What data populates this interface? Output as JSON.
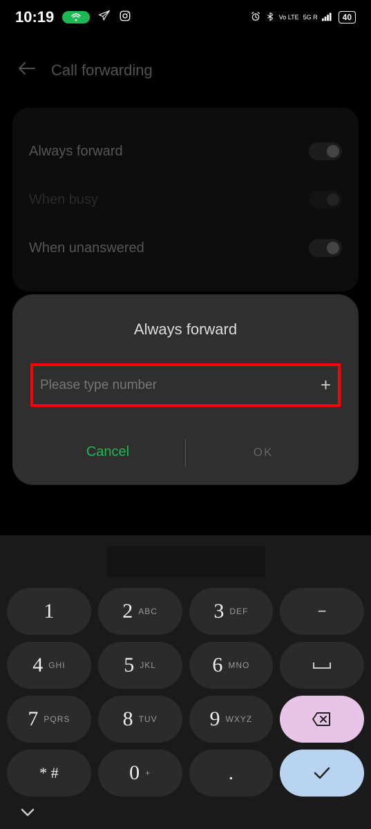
{
  "status": {
    "time": "10:19",
    "battery": "40",
    "volte": "Vo LTE",
    "network": "5G R"
  },
  "header": {
    "title": "Call forwarding"
  },
  "settings": {
    "always": "Always forward",
    "busy": "When busy",
    "unanswered": "When unanswered"
  },
  "dialog": {
    "title": "Always forward",
    "placeholder": "Please type number",
    "cancel": "Cancel",
    "ok": "OK"
  },
  "keypad": {
    "keys": [
      {
        "num": "1",
        "letters": ""
      },
      {
        "num": "2",
        "letters": "ABC"
      },
      {
        "num": "3",
        "letters": "DEF"
      },
      {
        "num": "4",
        "letters": "GHI"
      },
      {
        "num": "5",
        "letters": "JKL"
      },
      {
        "num": "6",
        "letters": "MNO"
      },
      {
        "num": "7",
        "letters": "PQRS"
      },
      {
        "num": "8",
        "letters": "TUV"
      },
      {
        "num": "9",
        "letters": "WXYZ"
      },
      {
        "num": "* #",
        "letters": ""
      },
      {
        "num": "0",
        "letters": "+"
      },
      {
        "num": ".",
        "letters": ""
      }
    ],
    "minus": "−",
    "space": "␣"
  }
}
